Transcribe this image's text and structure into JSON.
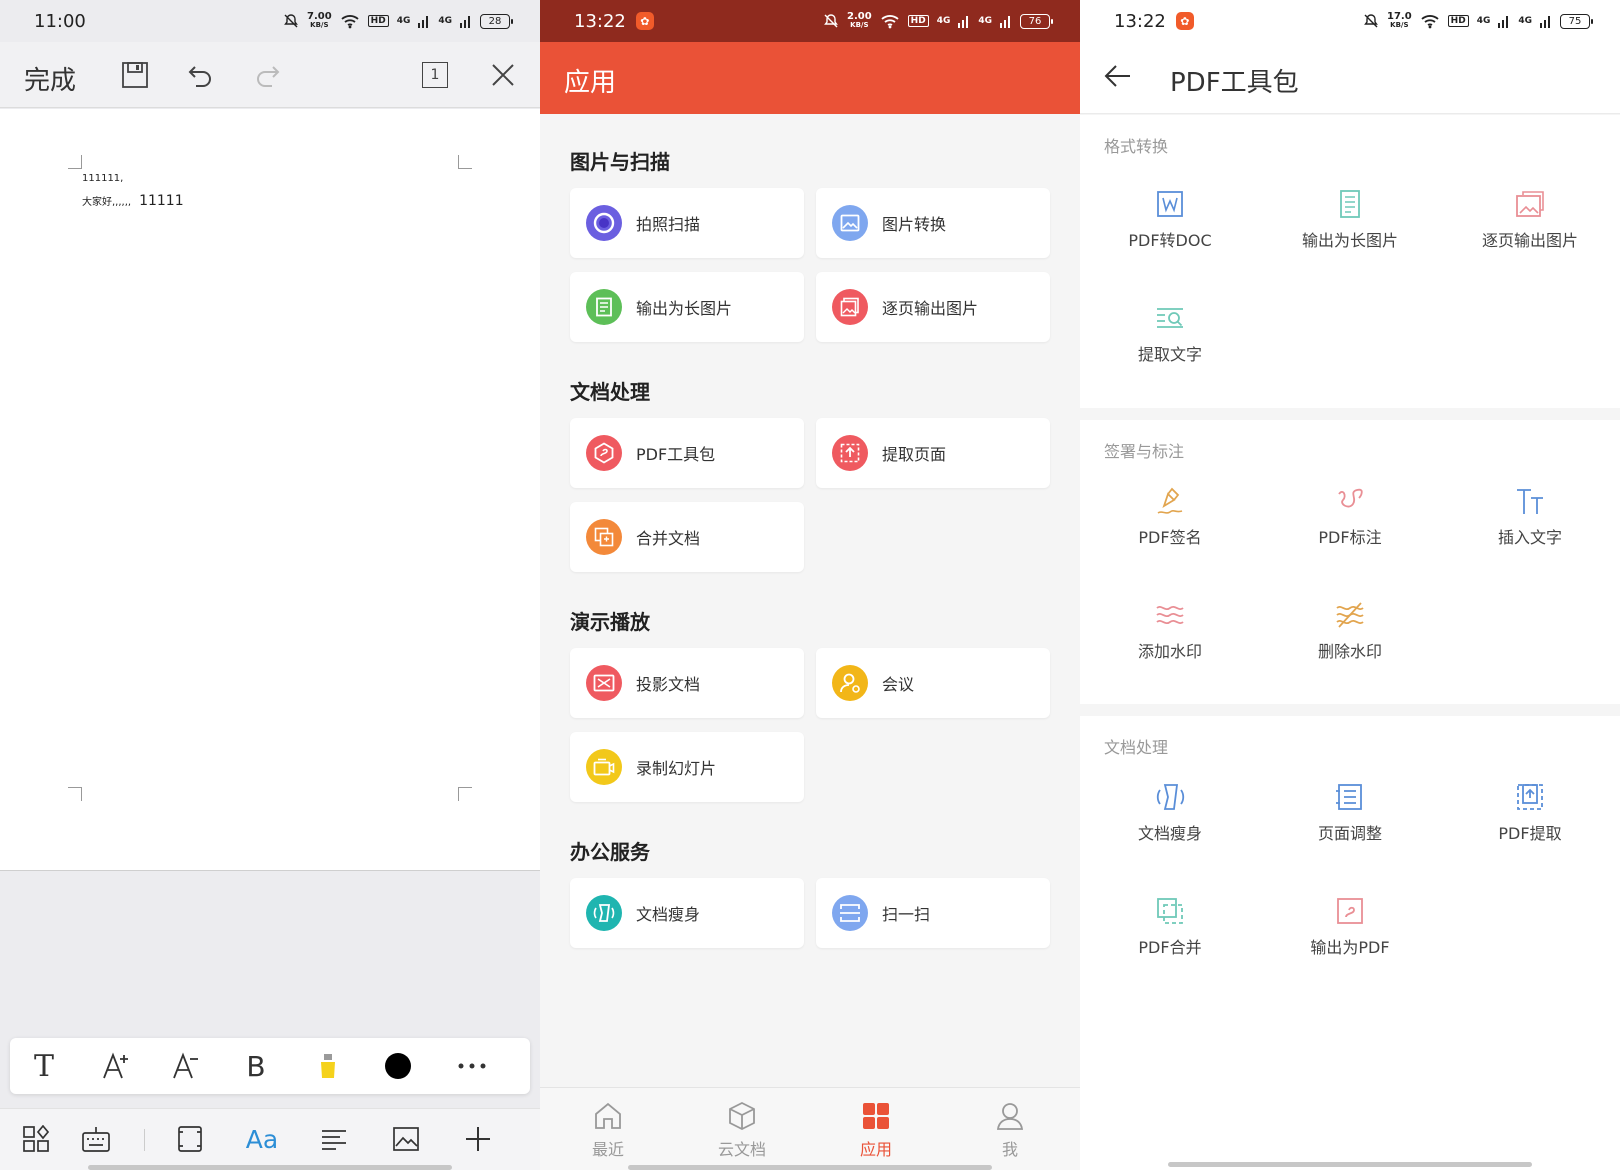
{
  "editor": {
    "status_time": "11:00",
    "status_speed_top": "7.00",
    "status_speed_unit": "KB/S",
    "status_hd": "HD",
    "status_signal": "4G",
    "status_battery": "28",
    "done_label": "完成",
    "page_number": "1",
    "doc_line1": "111111,",
    "doc_line2_small": "大家好,,,,,,",
    "doc_line2_big": "11111",
    "format_bold": "B",
    "format_text": "T",
    "bottom_aa": "Aa"
  },
  "apps": {
    "status_time": "13:22",
    "status_speed_top": "2.00",
    "status_speed_unit": "KB/S",
    "status_hd": "HD",
    "status_signal": "4G",
    "status_battery": "76",
    "title": "应用",
    "sections": {
      "images": "图片与扫描",
      "docs": "文档处理",
      "present": "演示播放",
      "office": "办公服务"
    },
    "items": {
      "scan": "拍照扫描",
      "img_convert": "图片转换",
      "long_img": "输出为长图片",
      "page_img": "逐页输出图片",
      "pdf_kit": "PDF工具包",
      "extract_page": "提取页面",
      "merge_doc": "合并文档",
      "project_doc": "投影文档",
      "meeting": "会议",
      "record_slides": "录制幻灯片",
      "slim_doc": "文档瘦身",
      "scan_qr": "扫一扫"
    },
    "tabs": {
      "recent": "最近",
      "cloud": "云文档",
      "apps": "应用",
      "me": "我"
    },
    "colors": {
      "accent": "#ea5237"
    }
  },
  "pdfkit": {
    "status_time": "13:22",
    "status_speed_top": "17.0",
    "status_speed_unit": "KB/S",
    "status_hd": "HD",
    "status_signal": "4G",
    "status_battery": "75",
    "title": "PDF工具包",
    "sections": {
      "convert": "格式转换",
      "sign": "签署与标注",
      "docs": "文档处理"
    },
    "tools": {
      "pdf_to_doc": "PDF转DOC",
      "long_img": "输出为长图片",
      "page_img": "逐页输出图片",
      "extract_text": "提取文字",
      "pdf_sign": "PDF签名",
      "pdf_annotate": "PDF标注",
      "insert_text": "插入文字",
      "add_watermark": "添加水印",
      "remove_watermark": "删除水印",
      "slim_doc": "文档瘦身",
      "page_adjust": "页面调整",
      "pdf_extract": "PDF提取",
      "pdf_merge": "PDF合并",
      "export_pdf": "输出为PDF"
    }
  }
}
